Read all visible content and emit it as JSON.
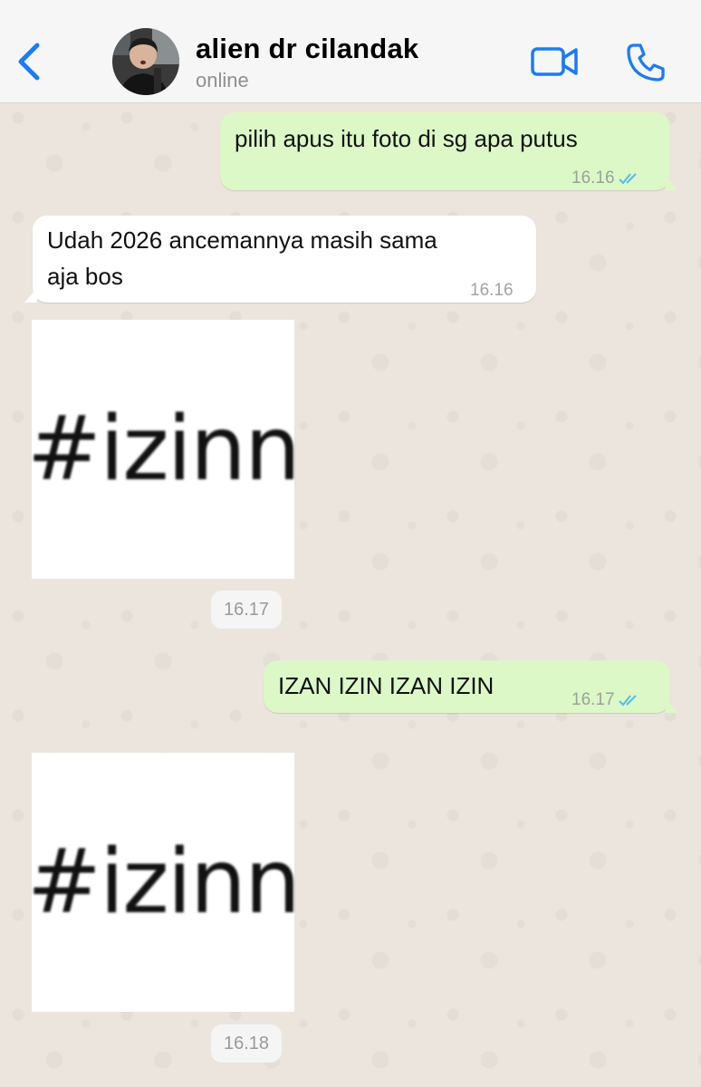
{
  "header": {
    "contact_name": "alien dr cilandak",
    "status": "online"
  },
  "messages": [
    {
      "type": "text",
      "direction": "outgoing",
      "text": "pilih apus itu foto di sg apa putus",
      "time": "16.16",
      "read": true
    },
    {
      "type": "text",
      "direction": "incoming",
      "text_line1": "Udah 2026 ancemannya masih sama",
      "text_line2": "aja bos",
      "time": "16.16"
    },
    {
      "type": "sticker",
      "direction": "incoming",
      "sticker_text": "#izinn",
      "time": "16.17"
    },
    {
      "type": "text",
      "direction": "outgoing",
      "text": "IZAN IZIN IZAN IZIN",
      "time": "16.17",
      "read": true
    },
    {
      "type": "sticker",
      "direction": "incoming",
      "sticker_text": "#izinn",
      "time": "16.18"
    }
  ],
  "colors": {
    "accent": "#1a7cf5",
    "outgoing_bubble": "#dcf8c6",
    "incoming_bubble": "#ffffff",
    "read_ticks": "#53bdeb",
    "chat_background": "#ece5dd"
  },
  "icons": [
    "back-chevron-icon",
    "video-call-icon",
    "phone-icon",
    "double-check-icon"
  ]
}
